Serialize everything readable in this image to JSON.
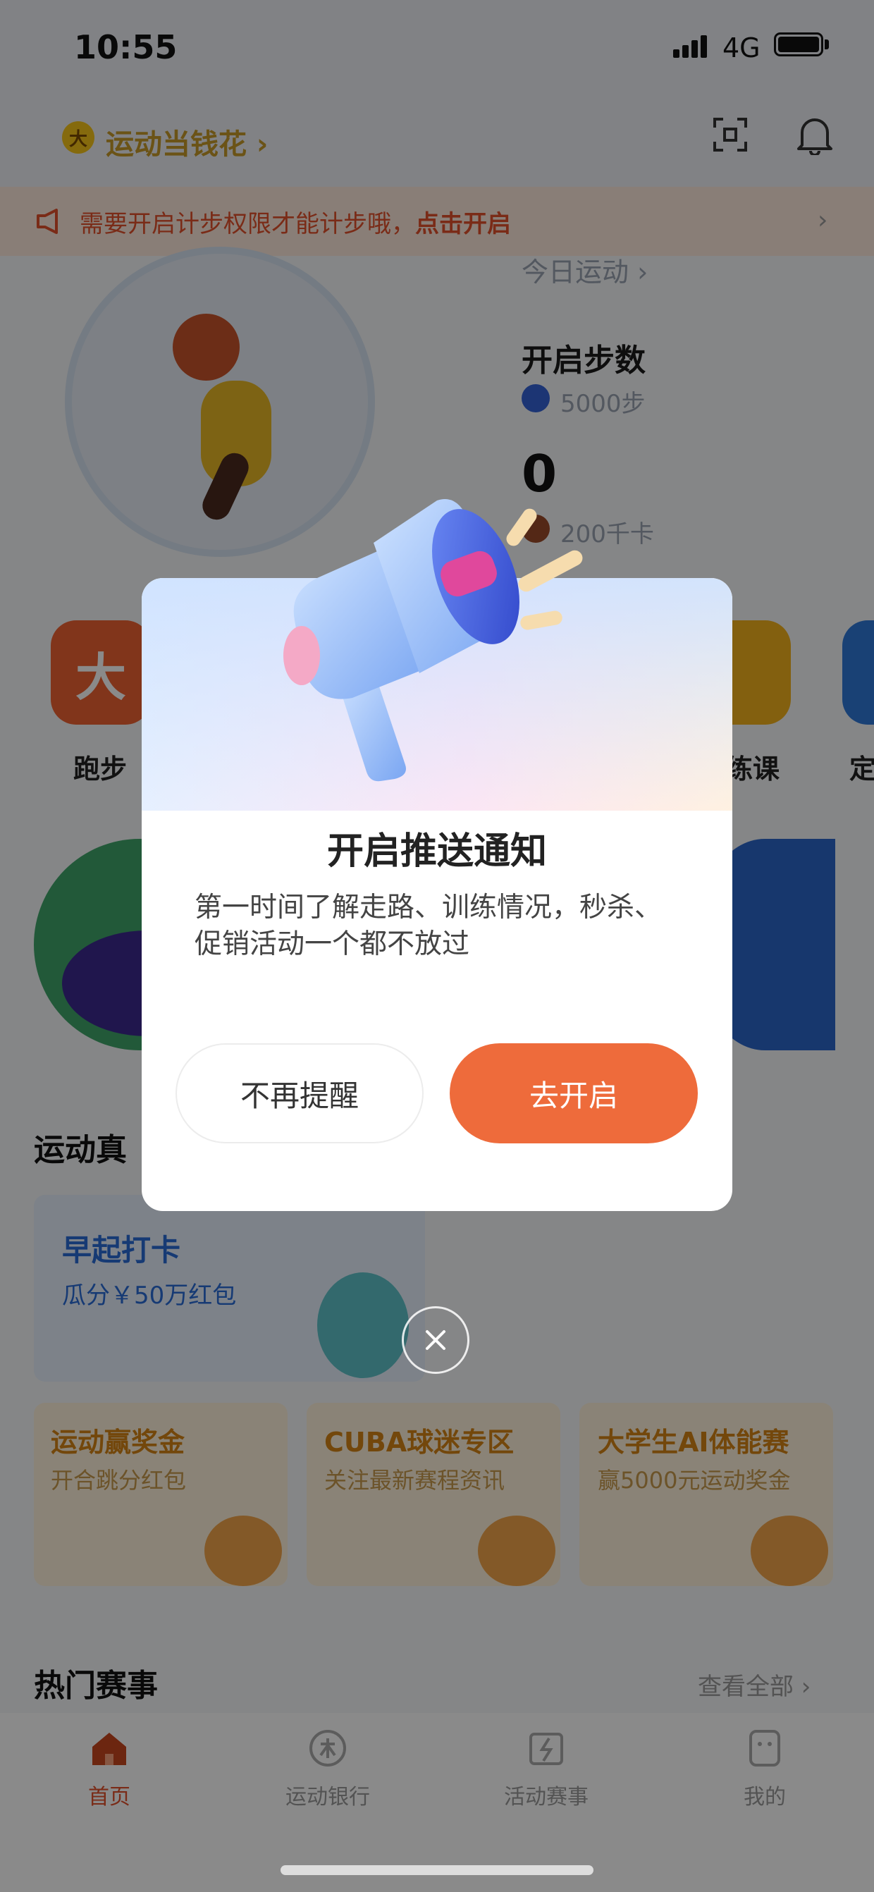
{
  "status_bar": {
    "time": "10:55",
    "network": "4G"
  },
  "header": {
    "brand_icon_text": "大",
    "brand_label": "运动当钱花 ›"
  },
  "notice": {
    "text": "需要开启计步权限才能计步哦，",
    "link": "点击开启",
    "chevron": "›"
  },
  "activity": {
    "today_label": "今日运动 ›",
    "open_steps": "开启步数",
    "step_target": "5000步",
    "step_count": "0",
    "kcal": "200千卡"
  },
  "tiles": [
    {
      "label": "跑步",
      "icon_text": "大"
    },
    {
      "label": "练课"
    },
    {
      "label": "定"
    }
  ],
  "section_title": "运动真",
  "morning_card": {
    "title": "早起打卡",
    "subtitle": "瓜分￥50万红包"
  },
  "promos": [
    {
      "title": "运动赢奖金",
      "subtitle": "开合跳分红包"
    },
    {
      "title": "CUBA球迷专区",
      "subtitle": "关注最新赛程资讯"
    },
    {
      "title": "大学生AI体能赛",
      "subtitle": "赢5000元运动奖金"
    }
  ],
  "hot": {
    "title": "热门赛事",
    "more": "查看全部 ›"
  },
  "tabbar": [
    {
      "label": "首页",
      "active": true
    },
    {
      "label": "运动银行"
    },
    {
      "label": "活动赛事"
    },
    {
      "label": "我的"
    }
  ],
  "modal": {
    "title": "开启推送通知",
    "description": "第一时间了解走路、训练情况，秒杀、促销活动一个都不放过",
    "secondary_button": "不再提醒",
    "primary_button": "去开启"
  },
  "colors": {
    "accent": "#ee6b3b",
    "brand_blue": "#2a6bd6"
  }
}
